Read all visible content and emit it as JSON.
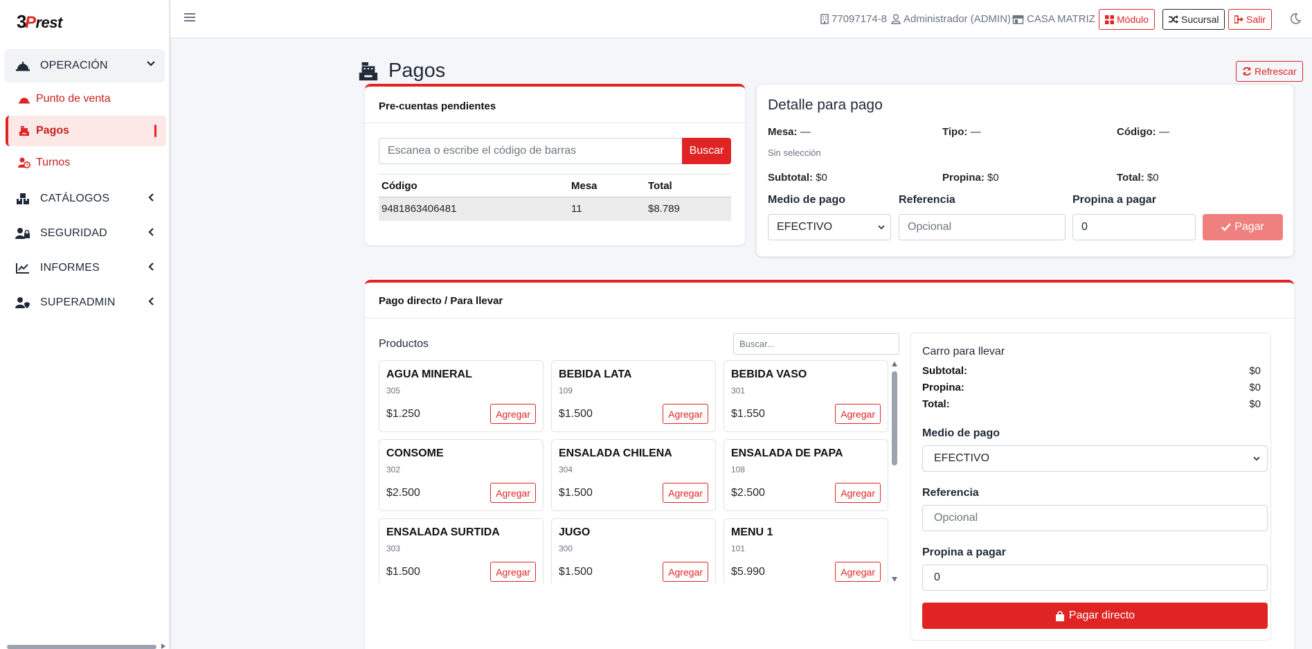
{
  "brand": {
    "logo_b": "3",
    "logo_p": "P",
    "logo_rest": "rest"
  },
  "sidebar": {
    "sections": [
      {
        "label": "OPERACIÓN",
        "icon": "bell-service-icon"
      },
      {
        "label": "CATÁLOGOS",
        "icon": "boxes-icon"
      },
      {
        "label": "SEGURIDAD",
        "icon": "user-lock-icon"
      },
      {
        "label": "INFORMES",
        "icon": "chart-line-icon"
      },
      {
        "label": "SUPERADMIN",
        "icon": "user-shield-icon"
      }
    ],
    "subitems": [
      {
        "label": "Punto de venta",
        "icon": "bell-service-icon"
      },
      {
        "label": "Pagos",
        "icon": "cash-register-icon",
        "active": true
      },
      {
        "label": "Turnos",
        "icon": "user-clock-icon"
      }
    ]
  },
  "topbar": {
    "rut": "77097174-8",
    "user": "Administrador (ADMIN)",
    "branch": "CASA MATRIZ",
    "btn_modulo": "Módulo",
    "btn_sucursal": "Sucursal",
    "btn_salir": "Salir"
  },
  "page": {
    "title": "Pagos",
    "refresh": "Refrescar"
  },
  "precuentas": {
    "title": "Pre-cuentas pendientes",
    "search_placeholder": "Escanea o escribe el código de barras",
    "search_button": "Buscar",
    "columns": [
      "Código",
      "Mesa",
      "Total"
    ],
    "rows": [
      {
        "codigo": "9481863406481",
        "mesa": "11",
        "total": "$8.789"
      }
    ]
  },
  "detalle": {
    "title": "Detalle para pago",
    "mesa_label": "Mesa:",
    "mesa_value": "—",
    "tipo_label": "Tipo:",
    "tipo_value": "—",
    "codigo_label": "Código:",
    "codigo_value": "—",
    "sin_seleccion": "Sin selección",
    "subtotal_label": "Subtotal:",
    "subtotal_value": "$0",
    "propina_label": "Propina:",
    "propina_value": "$0",
    "total_label": "Total:",
    "total_value": "$0",
    "medio_label": "Medio de pago",
    "medio_value": "EFECTIVO",
    "referencia_label": "Referencia",
    "referencia_placeholder": "Opcional",
    "propina_pagar_label": "Propina a pagar",
    "propina_pagar_value": "0",
    "pagar_button": "Pagar"
  },
  "directo": {
    "title": "Pago directo / Para llevar",
    "productos_label": "Productos",
    "search_placeholder": "Buscar...",
    "add_label": "Agregar",
    "products": [
      {
        "name": "AGUA MINERAL",
        "code": "305",
        "price": "$1.250"
      },
      {
        "name": "BEBIDA LATA",
        "code": "109",
        "price": "$1.500"
      },
      {
        "name": "BEBIDA VASO",
        "code": "301",
        "price": "$1.550"
      },
      {
        "name": "CONSOME",
        "code": "302",
        "price": "$2.500"
      },
      {
        "name": "ENSALADA CHILENA",
        "code": "304",
        "price": "$1.500"
      },
      {
        "name": "ENSALADA DE PAPA",
        "code": "108",
        "price": "$2.500"
      },
      {
        "name": "ENSALADA SURTIDA",
        "code": "303",
        "price": "$1.500"
      },
      {
        "name": "JUGO",
        "code": "300",
        "price": "$1.500"
      },
      {
        "name": "MENU 1",
        "code": "101",
        "price": "$5.990"
      }
    ],
    "cart": {
      "title": "Carro para llevar",
      "subtotal_label": "Subtotal:",
      "subtotal_value": "$0",
      "propina_label": "Propina:",
      "propina_value": "$0",
      "total_label": "Total:",
      "total_value": "$0",
      "medio_label": "Medio de pago",
      "medio_value": "EFECTIVO",
      "referencia_label": "Referencia",
      "referencia_placeholder": "Opcional",
      "propina_pagar_label": "Propina a pagar",
      "propina_pagar_value": "0",
      "pay_button": "Pagar directo"
    }
  },
  "colors": {
    "accent": "#e02424",
    "accent_soft": "#f07f7f",
    "active_bg": "#fde8e8"
  }
}
